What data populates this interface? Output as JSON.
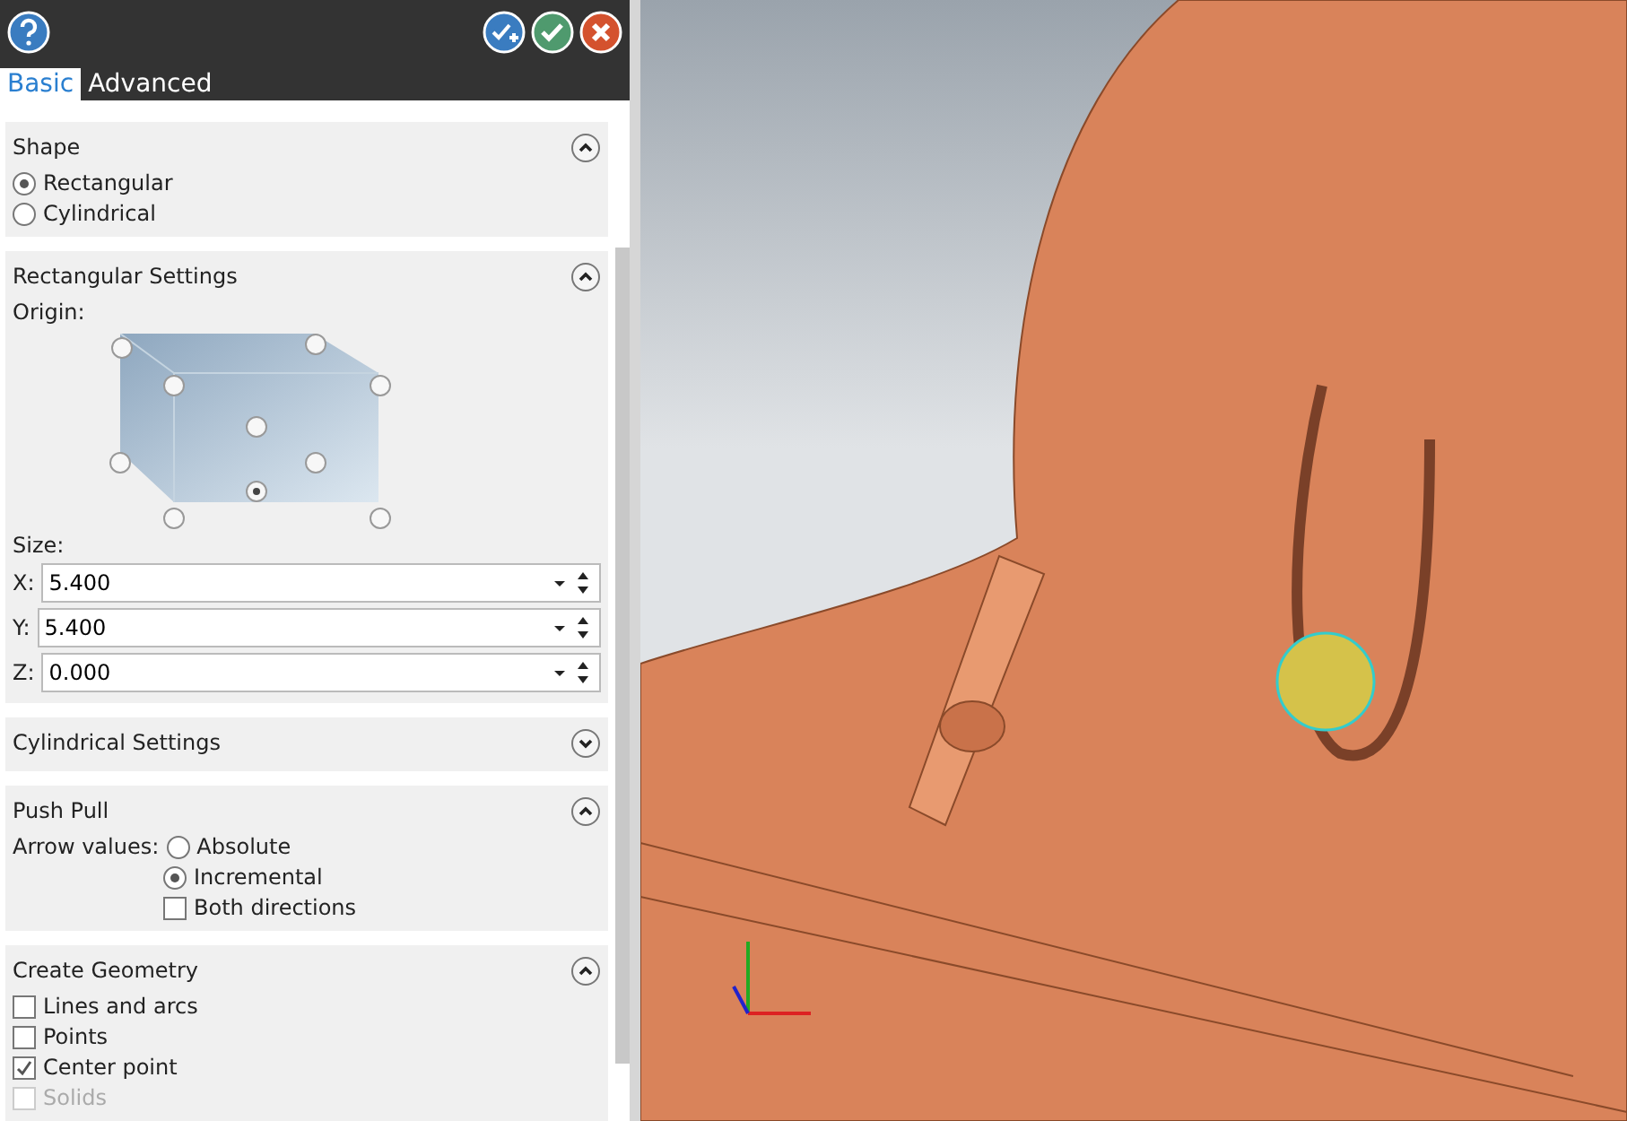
{
  "tabs": [
    {
      "label": "Basic",
      "selected": true
    },
    {
      "label": "Advanced",
      "selected": false
    }
  ],
  "sections": [
    {
      "kind": "shape",
      "title": "Shape",
      "expanded": true,
      "options": [
        {
          "label": "Rectangular",
          "selected": true
        },
        {
          "label": "Cylindrical",
          "selected": false
        }
      ]
    },
    {
      "kind": "rect",
      "title": "Rectangular Settings",
      "expanded": true,
      "origin_label": "Origin:",
      "origin_handles": [
        {
          "selected": false
        },
        {
          "selected": false
        },
        {
          "selected": false
        },
        {
          "selected": false
        },
        {
          "selected": false
        },
        {
          "selected": false
        },
        {
          "selected": false
        },
        {
          "selected": true
        },
        {
          "selected": false
        },
        {
          "selected": false
        }
      ],
      "size_label": "Size:",
      "fields": [
        {
          "label": "X:",
          "value": "5.400"
        },
        {
          "label": "Y:",
          "value": "5.400"
        },
        {
          "label": "Z:",
          "value": "0.000"
        }
      ]
    },
    {
      "kind": "cyl",
      "title": "Cylindrical Settings",
      "expanded": false
    },
    {
      "kind": "push",
      "title": "Push Pull",
      "expanded": true,
      "arrow_label": "Arrow values:",
      "options": [
        {
          "label": "Absolute",
          "selected": false
        },
        {
          "label": "Incremental",
          "selected": true
        }
      ],
      "both": {
        "label": "Both directions",
        "checked": false
      }
    },
    {
      "kind": "geom",
      "title": "Create Geometry",
      "expanded": true,
      "checks": [
        {
          "label": "Lines and arcs",
          "checked": false,
          "disabled": false
        },
        {
          "label": "Points",
          "checked": false,
          "disabled": false
        },
        {
          "label": "Center point",
          "checked": true,
          "disabled": false
        },
        {
          "label": "Solids",
          "checked": false,
          "disabled": true
        }
      ]
    }
  ]
}
